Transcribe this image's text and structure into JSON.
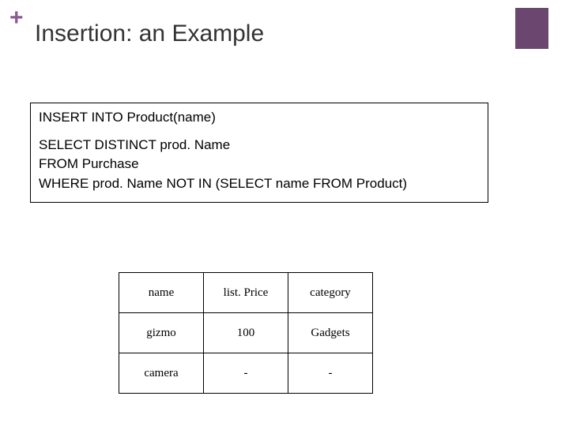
{
  "header": {
    "plus": "+",
    "title": "Insertion: an Example"
  },
  "sql": {
    "line1": "INSERT   INTO   Product(name)",
    "line2": "SELECT  DISTINCT  prod. Name",
    "line3": "FROM      Purchase",
    "line4": "WHERE   prod. Name  NOT IN (SELECT  name FROM  Product)"
  },
  "table": {
    "headers": [
      "name",
      "list. Price",
      "category"
    ],
    "rows": [
      [
        "gizmo",
        "100",
        "Gadgets"
      ],
      [
        "camera",
        "-",
        "-"
      ]
    ]
  }
}
